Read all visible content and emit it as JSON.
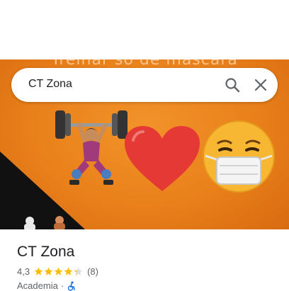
{
  "photo": {
    "caption": "Treinar só de máscara",
    "emojis": [
      "weightlifter-emoji",
      "red-heart-emoji",
      "face-with-mask-emoji"
    ]
  },
  "search": {
    "query": "CT Zona"
  },
  "place": {
    "name": "CT Zona",
    "rating": "4,3",
    "rating_value": 4.3,
    "review_count": "(8)",
    "category": "Academia",
    "separator": "·"
  },
  "colors": {
    "photo_orange": "#e9801a",
    "star_gold": "#fbbc04",
    "text_primary": "#202124",
    "text_secondary": "#5f6368"
  }
}
